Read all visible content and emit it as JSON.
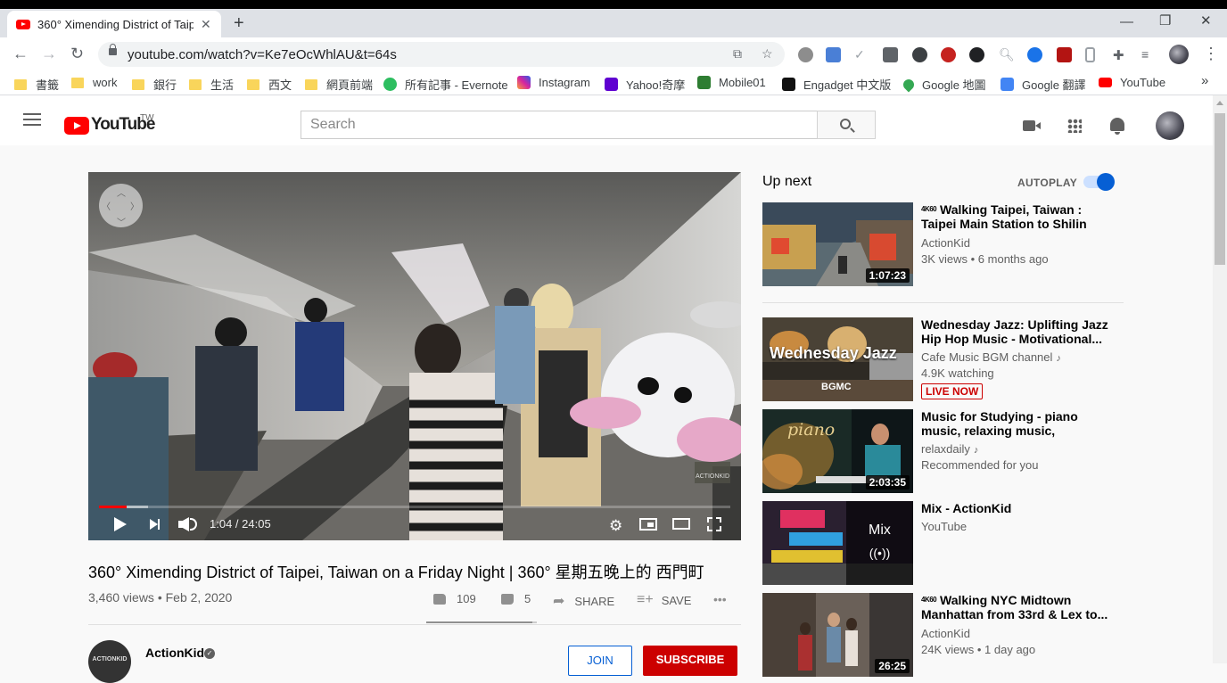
{
  "browser": {
    "tab_title": "360° Ximending District of Taip",
    "tab_close": "✕",
    "new_tab": "+",
    "url": "youtube.com/watch?v=Ke7eOcWhlAU&t=64s",
    "bookmarks": [
      {
        "label": "書籤",
        "icon": "folder-icon"
      },
      {
        "label": "work",
        "icon": "folder-icon"
      },
      {
        "label": "銀行",
        "icon": "folder-icon"
      },
      {
        "label": "生活",
        "icon": "folder-icon"
      },
      {
        "label": "西文",
        "icon": "folder-icon"
      },
      {
        "label": "網頁前端",
        "icon": "folder-icon"
      },
      {
        "label": "所有記事 - Evernote",
        "icon": "evernote-icon"
      },
      {
        "label": "Instagram",
        "icon": "instagram-icon"
      },
      {
        "label": "Yahoo!奇摩",
        "icon": "yahoo-icon"
      },
      {
        "label": "Mobile01",
        "icon": "mobile01-icon"
      },
      {
        "label": "Engadget 中文版",
        "icon": "engadget-icon"
      },
      {
        "label": "Google 地圖",
        "icon": "maps-icon"
      },
      {
        "label": "Google 翻譯",
        "icon": "translate-icon"
      },
      {
        "label": "YouTube",
        "icon": "youtube-icon"
      }
    ],
    "more_bookmarks": "»"
  },
  "masthead": {
    "logo_text": "YouTube",
    "region": "TW",
    "search_placeholder": "Search"
  },
  "player": {
    "current_time": "1:04",
    "duration": "24:05",
    "time_text": "1:04 / 24:05",
    "progress_fraction": 0.044,
    "watermark": "ACTIONKID"
  },
  "video": {
    "title": "360° Ximending District of Taipei, Taiwan on a Friday Night | 360° 星期五晚上的 西門町",
    "meta": "3,460 views • Feb 2, 2020",
    "likes": "109",
    "dislikes": "5",
    "like_fraction": 0.956,
    "share_label": "SHARE",
    "save_label": "SAVE",
    "more": "•••",
    "channel": "ActionKid",
    "channel_avatar_text": "ACTIONKID",
    "join_label": "JOIN",
    "subscribe_label": "SUBSCRIBE"
  },
  "sidebar": {
    "upnext_label": "Up next",
    "autoplay_label": "AUTOPLAY",
    "autoplay_on": true,
    "items": [
      {
        "badge": "4K60",
        "title": "Walking Taipei, Taiwan : Taipei Main Station to Shilin in...",
        "channel": "ActionKid",
        "meta": "3K views • 6 months ago",
        "duration": "1:07:23"
      },
      {
        "title": "Wednesday Jazz: Uplifting Jazz Hip Hop Music - Motivational...",
        "channel": "Cafe Music BGM channel",
        "meta": "4.9K watching",
        "live": "LIVE NOW",
        "thumb_text": "Wednesday Jazz",
        "thumb_sub": "BGMC"
      },
      {
        "title": "Music for Studying - piano music, relaxing music, smooth...",
        "channel": "relaxdaily",
        "meta": "Recommended for you",
        "duration": "2:03:35",
        "thumb_text": "piano"
      },
      {
        "title": "Mix - ActionKid",
        "channel": "YouTube",
        "mix_label": "Mix",
        "mix_icon": "((•))"
      },
      {
        "badge": "4K60",
        "title": "Walking NYC Midtown Manhattan from 33rd & Lex to...",
        "channel": "ActionKid",
        "meta": "24K views • 1 day ago",
        "duration": "26:25"
      }
    ]
  },
  "colors": {
    "youtube_red": "#ff0000",
    "subscribe_red": "#cc0000",
    "link_blue": "#065fd4",
    "bg": "#f9f9f9"
  }
}
